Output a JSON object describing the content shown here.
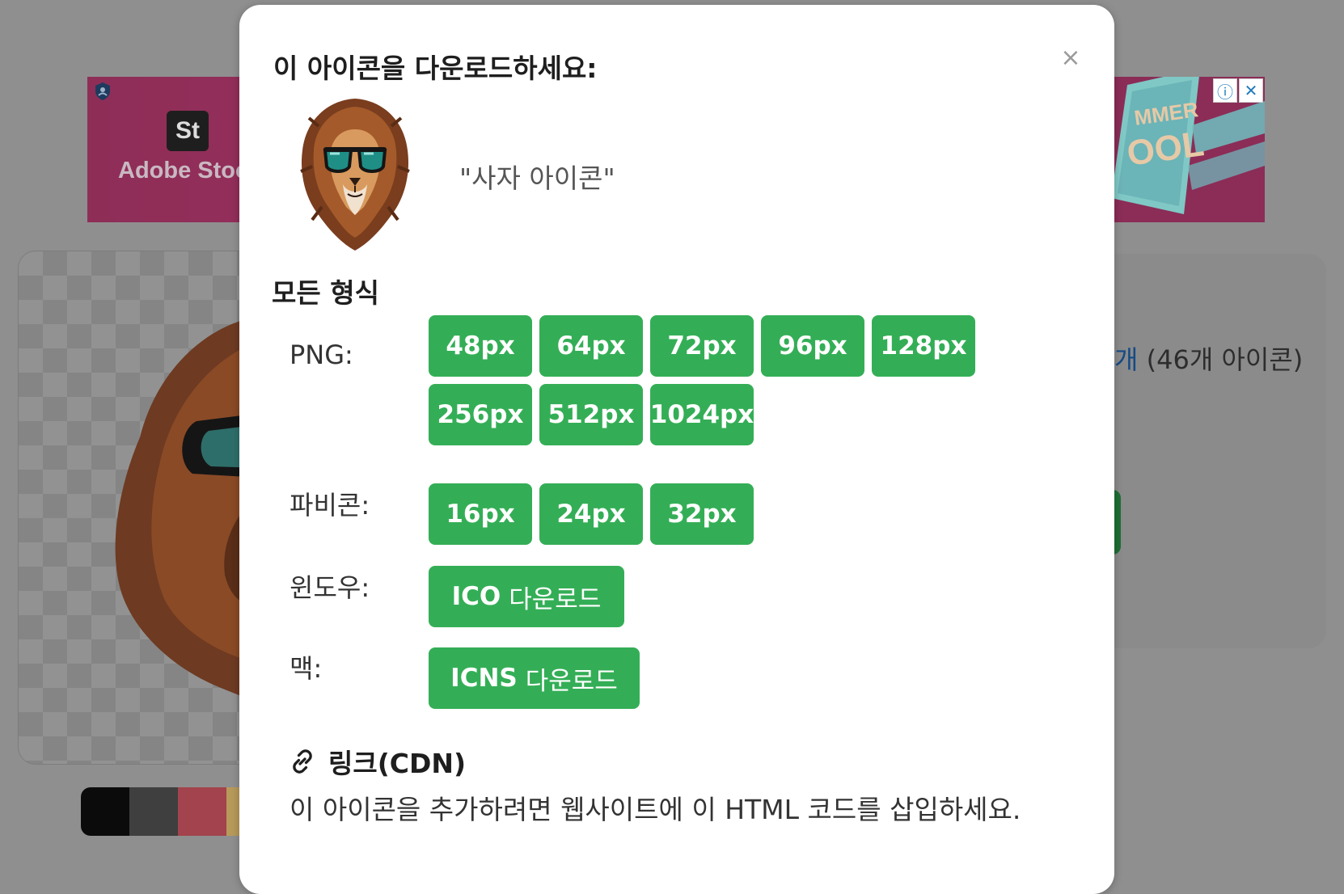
{
  "background": {
    "ad": {
      "brand_badge": "St",
      "brand_text": "Adobe Stoc",
      "info_icon": "info-icon",
      "close_icon": "close-icon"
    },
    "collection_link": "개",
    "collection_count": " (46개 아이콘)",
    "swatch_colors": [
      "#0b0b0b",
      "#3f3f3f",
      "#a3434d",
      "#b79a5a"
    ]
  },
  "modal": {
    "title": "이 아이콘을 다운로드하세요:",
    "close_label": "×",
    "icon_caption": "\"사자 아이콘\"",
    "formats_heading": "모든 형식",
    "png_label": "PNG:",
    "png_sizes": [
      "48px",
      "64px",
      "72px",
      "96px",
      "128px",
      "256px",
      "512px",
      "1024px"
    ],
    "favicon_label": "파비콘:",
    "favicon_sizes": [
      "16px",
      "24px",
      "32px"
    ],
    "windows_label": "윈도우:",
    "windows_button": {
      "prefix": "ICO",
      "text": "다운로드"
    },
    "mac_label": "맥:",
    "mac_button": {
      "prefix": "ICNS",
      "text": "다운로드"
    },
    "cdn_heading": "링크(CDN)",
    "cdn_description": "이 아이콘을 추가하려면 웹사이트에 이 HTML 코드를 삽입하세요."
  },
  "colors": {
    "button_green": "#34ae56",
    "overlay": "#8f8f8f"
  }
}
